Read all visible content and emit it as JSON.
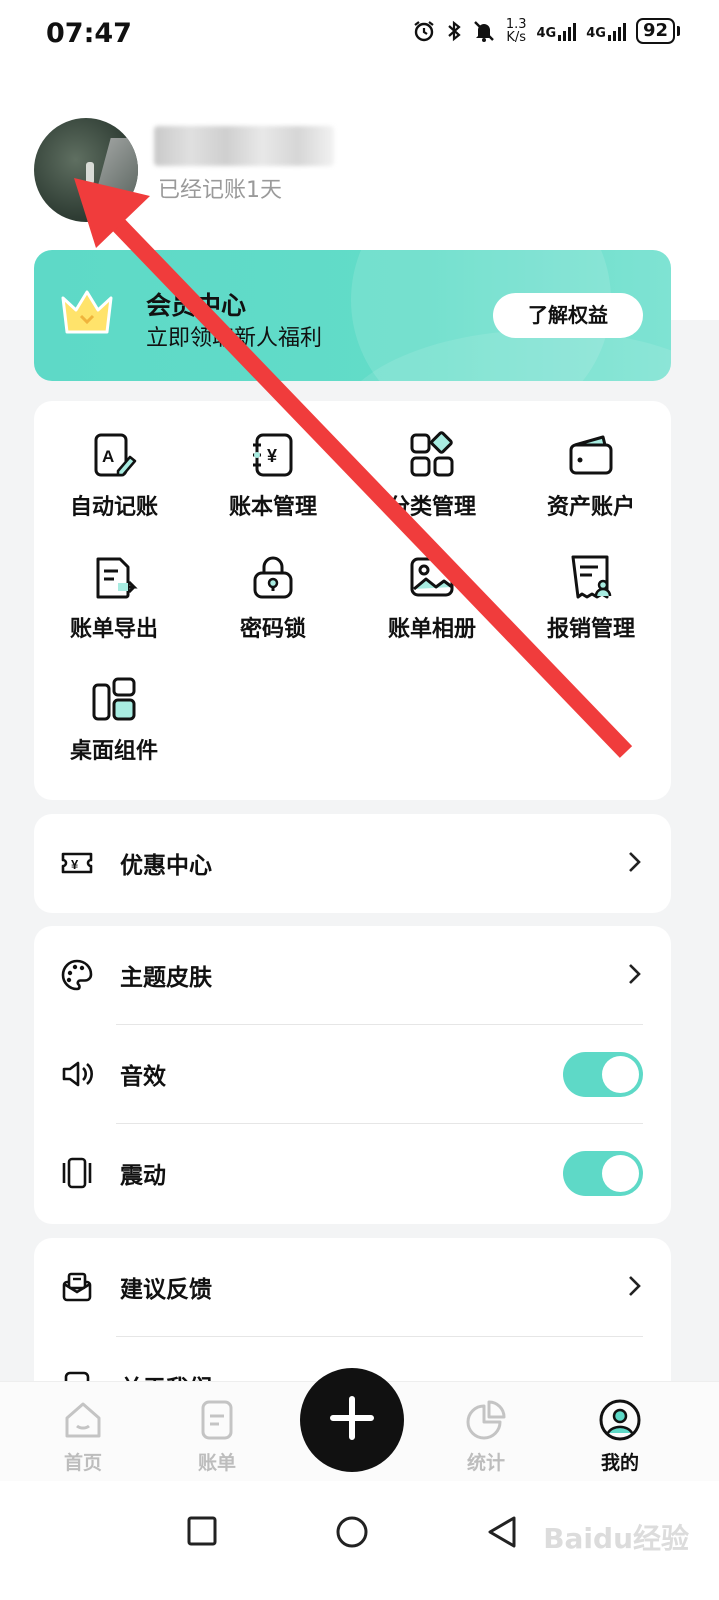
{
  "status_bar": {
    "time": "07:47",
    "net_speed_value": "1.3",
    "net_speed_unit": "K/s",
    "sim1": "4G",
    "sim2": "4G",
    "battery": "92"
  },
  "profile": {
    "days_text": "已经记账1天"
  },
  "vip": {
    "title": "会员中心",
    "subtitle": "立即领取新人福利",
    "button": "了解权益",
    "accent": "#5ed9c7"
  },
  "tools": [
    {
      "label": "自动记账",
      "icon": "auto-bookkeeping-icon"
    },
    {
      "label": "账本管理",
      "icon": "ledger-icon"
    },
    {
      "label": "分类管理",
      "icon": "category-icon"
    },
    {
      "label": "资产账户",
      "icon": "wallet-icon"
    },
    {
      "label": "账单导出",
      "icon": "export-icon"
    },
    {
      "label": "密码锁",
      "icon": "lock-icon"
    },
    {
      "label": "账单相册",
      "icon": "album-icon"
    },
    {
      "label": "报销管理",
      "icon": "reimbursement-icon"
    },
    {
      "label": "桌面组件",
      "icon": "widget-icon"
    }
  ],
  "coupon": {
    "label": "优惠中心"
  },
  "settings": {
    "theme": "主题皮肤",
    "sound": "音效",
    "sound_on": true,
    "vibration": "震动",
    "vibration_on": true
  },
  "more": {
    "feedback": "建议反馈",
    "about": "关于我们"
  },
  "tabs": [
    {
      "label": "首页",
      "active": false
    },
    {
      "label": "账单",
      "active": false
    },
    {
      "label": "统计",
      "active": false
    },
    {
      "label": "我的",
      "active": true
    }
  ],
  "watermark": "Baidu经验"
}
